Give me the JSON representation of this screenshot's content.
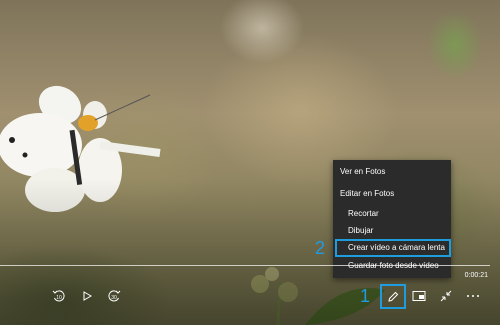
{
  "menu": {
    "items": [
      {
        "label": "Ver en Fotos"
      },
      {
        "label": "Editar en Fotos"
      },
      {
        "label": "Recortar"
      },
      {
        "label": "Dibujar"
      },
      {
        "label": "Crear vídeo a cámara lenta"
      },
      {
        "label": "Guardar foto desde vídeo"
      }
    ]
  },
  "annotations": {
    "step1": "1",
    "step2": "2"
  },
  "player": {
    "time": "0:00:21",
    "controls": [
      "skip-back-10-icon",
      "play-icon",
      "skip-forward-30-icon",
      "edit-pencil-icon",
      "mini-view-icon",
      "exit-fullscreen-icon",
      "more-icon"
    ]
  },
  "colors": {
    "accent": "#1f9be0",
    "menu_bg": "#2b2b2b"
  }
}
